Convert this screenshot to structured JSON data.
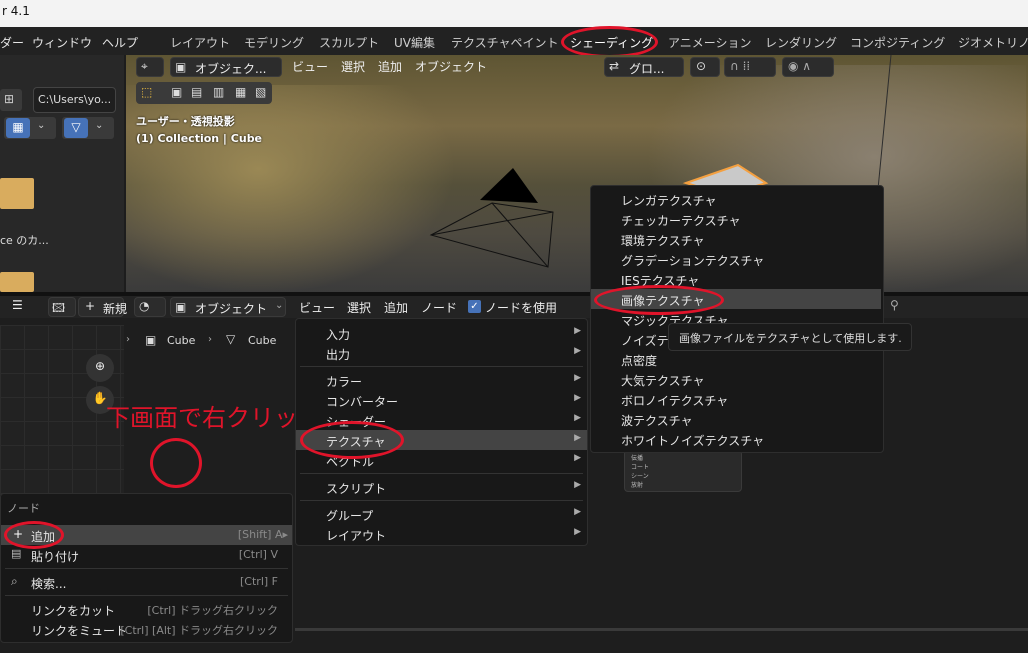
{
  "window": {
    "title": "r 4.1"
  },
  "topbar": {
    "menus": [
      "ダー",
      "ウィンドウ",
      "ヘルプ"
    ],
    "workspaces": [
      "レイアウト",
      "モデリング",
      "スカルプト",
      "UV編集",
      "テクスチャペイント",
      "シェーディング",
      "アニメーション",
      "レンダリング",
      "コンポジティング",
      "ジオメトリノー"
    ],
    "active_workspace": "シェーディング"
  },
  "file_browser": {
    "path": "C:\\Users\\yo...",
    "item_label": "ce のカ..."
  },
  "viewport": {
    "mode": "オブジェク...",
    "menus": [
      "ビュー",
      "選択",
      "追加",
      "オブジェクト"
    ],
    "transform": "グロ...",
    "view_name": "ユーザー・透視投影",
    "collection": "(1) Collection | Cube"
  },
  "node_editor": {
    "new_label": "新規",
    "object_mode": "オブジェクト",
    "menus": [
      "ビュー",
      "選択",
      "追加",
      "ノード"
    ],
    "use_nodes_label": "ノードを使用",
    "use_nodes_checked": true,
    "breadcrumb": [
      "Cube",
      "Cube"
    ],
    "annotation": "下画面で右クリック"
  },
  "context_menu": {
    "title": "ノード",
    "items": [
      {
        "label": "追加",
        "shortcut": "[Shift] A▸",
        "icon": "+"
      },
      {
        "label": "貼り付け",
        "shortcut": "[Ctrl] V",
        "icon": "paste"
      },
      {
        "label": "検索...",
        "shortcut": "[Ctrl] F",
        "icon": "search"
      },
      {
        "label": "リンクをカット",
        "shortcut": "[Ctrl] ドラッグ右クリック"
      },
      {
        "label": "リンクをミュート",
        "shortcut": "[Ctrl] [Alt] ドラッグ右クリック"
      }
    ]
  },
  "add_menu": {
    "items": [
      "入力",
      "出力",
      "カラー",
      "コンバーター",
      "シェーダー",
      "テクスチャ",
      "ベクトル",
      "スクリプト",
      "グループ",
      "レイアウト"
    ],
    "highlighted": "テクスチャ"
  },
  "texture_menu": {
    "items": [
      "レンガテクスチャ",
      "チェッカーテクスチャ",
      "環境テクスチャ",
      "グラデーションテクスチャ",
      "IESテクスチャ",
      "画像テクスチャ",
      "マジックテクスチャ",
      "ノイズテクスチャ",
      "点密度",
      "大気テクスチャ",
      "ボロノイテクスチャ",
      "波テクスチャ",
      "ホワイトノイズテクスチャ"
    ],
    "highlighted": "画像テクスチャ"
  },
  "tooltip": {
    "text": "画像ファイルをテクスチャとして使用します."
  },
  "node_preview": {
    "rows": [
      "伝播",
      "コート",
      "シーン",
      "放射"
    ]
  }
}
